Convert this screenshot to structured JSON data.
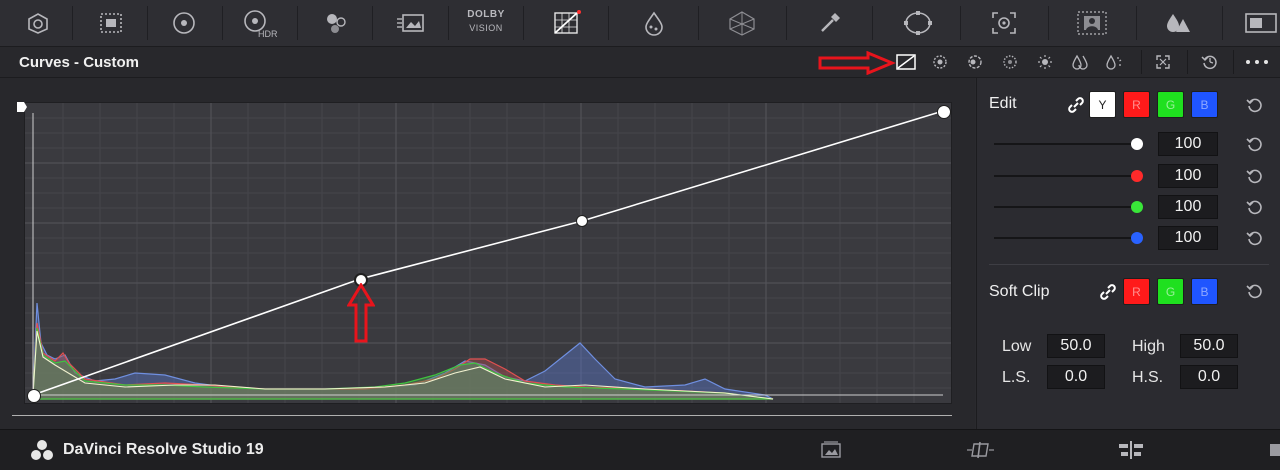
{
  "toolbar": {
    "tools": [
      "camera-raw-icon",
      "color-match-icon",
      "color-wheels-icon",
      "hdr-wheels-icon",
      "rgb-mixer-icon",
      "motion-effects-icon",
      "dolby-vision-icon",
      "curves-icon",
      "color-warper-icon",
      "color-warper-mesh-icon",
      "qualifier-icon",
      "window-icon",
      "tracker-icon",
      "magic-mask-icon",
      "blur-icon",
      "key-icon"
    ],
    "hdr_label": "HDR",
    "dolby_line1": "DOLBY",
    "dolby_line2": "VISION"
  },
  "panel": {
    "title": "Curves - Custom"
  },
  "edit": {
    "label": "Edit",
    "channels": [
      "Y",
      "R",
      "G",
      "B"
    ],
    "sliders": [
      {
        "channel": "Y",
        "value": "100",
        "color": "#ffffff"
      },
      {
        "channel": "R",
        "value": "100",
        "color": "#ff2a2a"
      },
      {
        "channel": "G",
        "value": "100",
        "color": "#39e639"
      },
      {
        "channel": "B",
        "value": "100",
        "color": "#2962ff"
      }
    ]
  },
  "soft_clip": {
    "label": "Soft Clip",
    "channels": [
      "R",
      "G",
      "B"
    ],
    "low_label": "Low",
    "low_value": "50.0",
    "high_label": "High",
    "high_value": "50.0",
    "ls_label": "L.S.",
    "ls_value": "0.0",
    "hs_label": "H.S.",
    "hs_value": "0.0"
  },
  "status_bar": {
    "app_name": "DaVinci Resolve Studio 19"
  },
  "colors": {
    "red": "#ff1a1a",
    "green": "#1fe01f",
    "blue": "#1f55ff",
    "annotation": "#e8141c"
  }
}
